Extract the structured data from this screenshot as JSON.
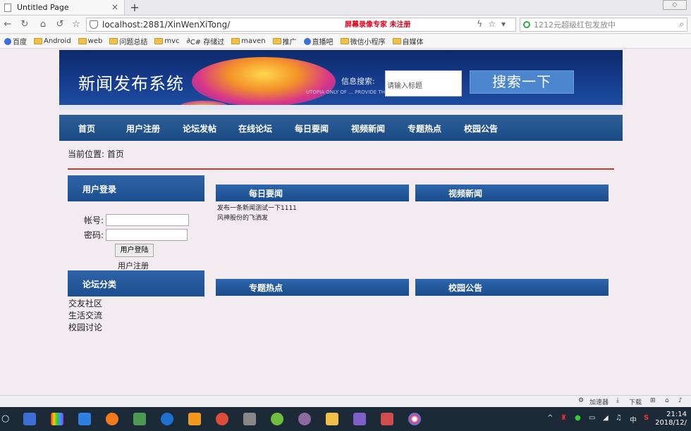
{
  "browser": {
    "tab_title": "Untitled Page",
    "url": "localhost:2881/XinWenXiTong/",
    "recorder_watermark": "屏幕录像专家  未注册",
    "search_placeholder": "1212元超级红包发放中",
    "bookmarks": [
      "百度",
      "Android",
      "web",
      "问题总结",
      "mvc",
      "C# 存储过",
      "maven",
      "推广",
      "直播吧",
      "微信小程序",
      "自媒体"
    ]
  },
  "site": {
    "title": "新闻发布系统",
    "search_label": "信息搜索:",
    "search_placeholder": "请输入标题",
    "search_button": "搜索一下",
    "banner_small": "UTOPIA ONLY OF ... PROVIDE THE CLASS PERIOD"
  },
  "menu": [
    "首页",
    "用户注册",
    "论坛发帖",
    "在线论坛",
    "每日要闻",
    "视频新闻",
    "专题热点",
    "校园公告"
  ],
  "breadcrumb": "当前位置:  首页",
  "sidebar": {
    "login_title": "用户登录",
    "account_label": "帐号:",
    "password_label": "密码:",
    "login_button": "用户登陆",
    "register_link": "用户注册",
    "forum_title": "论坛分类",
    "categories": [
      "交友社区",
      "生活交流",
      "校园讨论"
    ]
  },
  "sections": {
    "daily": "每日要闻",
    "video": "视频新闻",
    "topics": "专题热点",
    "notice": "校园公告",
    "daily_items": [
      "发布一条新闻测试一下1111",
      "风神股份的飞洒发"
    ]
  },
  "statusbar": {
    "accelerator": "加速器",
    "download": "下载"
  },
  "taskbar": {
    "time": "21:14",
    "date": "2018/12/",
    "ime": "中"
  }
}
